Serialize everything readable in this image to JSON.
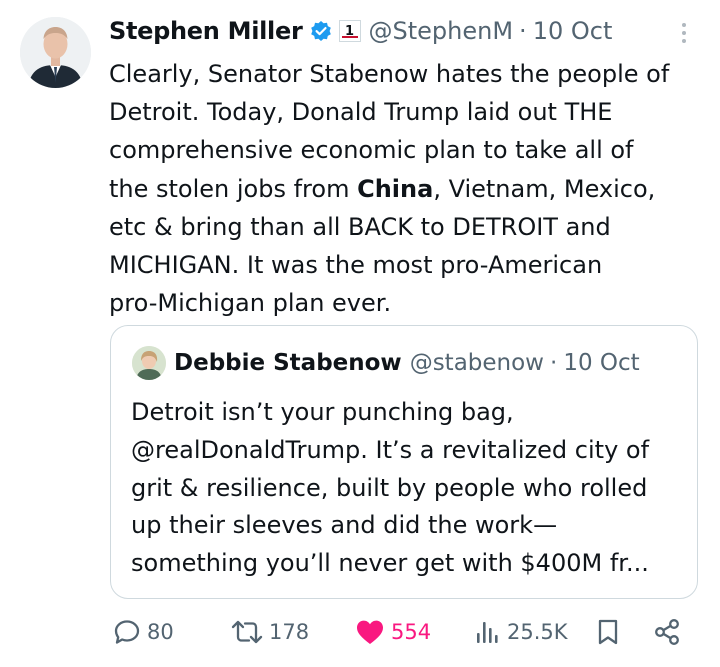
{
  "tweet": {
    "author_name": "Stephen Miller",
    "handle": "@StephenM",
    "separator": "·",
    "timestamp": "10 Oct",
    "lines": [
      [
        {
          "t": "Clearly, Senator Stabenow hates the people of",
          "b": false
        }
      ],
      [
        {
          "t": "Detroit. Today, Donald Trump laid out THE",
          "b": false
        }
      ],
      [
        {
          "t": "comprehensive economic plan to take all of",
          "b": false
        }
      ],
      [
        {
          "t": "the stolen jobs from ",
          "b": false
        },
        {
          "t": "China",
          "b": true
        },
        {
          "t": ", Vietnam, Mexico,",
          "b": false
        }
      ],
      [
        {
          "t": "etc & bring than all BACK to DETROIT and",
          "b": false
        }
      ],
      [
        {
          "t": "MICHIGAN. It was the most pro-American",
          "b": false
        }
      ],
      [
        {
          "t": "pro-Michigan plan ever.",
          "b": false
        }
      ]
    ]
  },
  "quoted_tweet": {
    "author_name": "Debbie Stabenow",
    "handle": "@stabenow",
    "separator": "·",
    "timestamp": "10 Oct",
    "lines": [
      "Detroit isn’t your punching bag,",
      "@realDonaldTrump. It’s a revitalized city of",
      "grit & resilience, built by people who rolled",
      "up their sleeves and did the work—",
      "something you’ll never get with $400M fr..."
    ]
  },
  "actions": {
    "replies": "80",
    "reposts": "178",
    "likes": "554",
    "views": "25.5K"
  },
  "colors": {
    "text": "#0f1419",
    "secondary": "#536471",
    "verified_blue": "#1d9bf0",
    "like_pink": "#f91880",
    "border": "#cfd9de"
  },
  "icons": [
    "verified-badge-icon",
    "flag-badge-icon",
    "more-options-icon",
    "reply-icon",
    "repost-icon",
    "like-icon",
    "views-icon",
    "bookmark-icon",
    "share-icon"
  ]
}
